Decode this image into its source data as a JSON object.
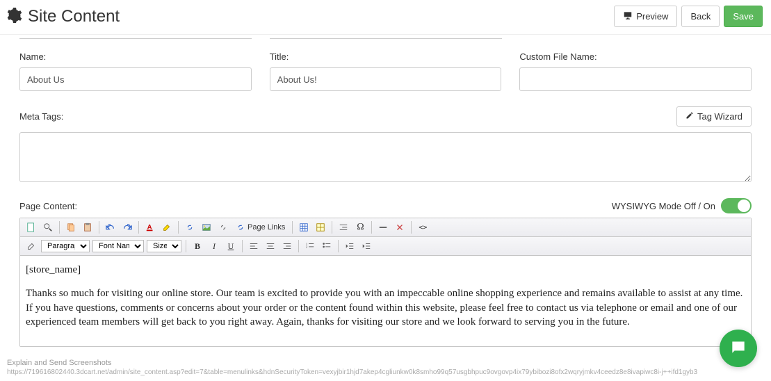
{
  "header": {
    "title": "Site Content",
    "preview": "Preview",
    "back": "Back",
    "save": "Save"
  },
  "fields": {
    "name_label": "Name:",
    "name_value": "About Us",
    "title_label": "Title:",
    "title_value": "About Us!",
    "custom_label": "Custom File Name:",
    "custom_value": ""
  },
  "meta": {
    "label": "Meta Tags:",
    "wizard": "Tag Wizard",
    "value": ""
  },
  "page_content": {
    "label": "Page Content:",
    "wysiwyg_label": "WYSIWYG Mode Off / On",
    "wysiwyg_on": true,
    "toolbar": {
      "page_links": "Page Links",
      "paragraph": "Paragraph",
      "font_name": "Font Name",
      "size": "Size"
    },
    "body": {
      "line1": "[store_name]",
      "line2": "Thanks so much for visiting our online store. Our team is excited to provide you with an impeccable online shopping experience and remains available to assist at any time. If you have questions, comments or concerns about your order or the content found within this website, please feel free to contact us via telephone or email and one of our experienced team members will get back to you right away.  Again, thanks for visiting our store and we look forward to serving you in the future."
    }
  },
  "footer": {
    "line1": "Explain and Send Screenshots",
    "line2": "https://719616802440.3dcart.net/admin/site_content.asp?edit=7&table=menulinks&hdnSecurityToken=vexyjbir1hjd7akep4cgliunkw0k8smho99q57usgbhpuc9ovgovp4ix79ybibozi8ofx2wqryjmkv4ceedz8e8ivapiwc8i-j++ifd1gyb3"
  }
}
